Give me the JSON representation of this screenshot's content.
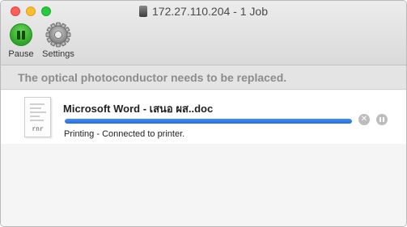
{
  "window": {
    "title": "172.27.110.204 - 1 Job"
  },
  "toolbar": {
    "pause_label": "Pause",
    "settings_label": "Settings"
  },
  "alert": {
    "message": "The optical photoconductor needs to be replaced."
  },
  "job": {
    "name": "Microsoft Word - เสนอ ผส..doc",
    "status": "Printing - Connected to printer.",
    "progress": 1.0,
    "icon_ext": "rnr"
  },
  "colors": {
    "progress": "#2a7af0",
    "alert_text": "#8c8c8c",
    "pause_green": "#2ea526"
  },
  "icons": {
    "pause": "pause-icon",
    "settings": "gear-icon",
    "cancel": "close-icon",
    "hold": "hold-icon",
    "document": "document-icon"
  }
}
